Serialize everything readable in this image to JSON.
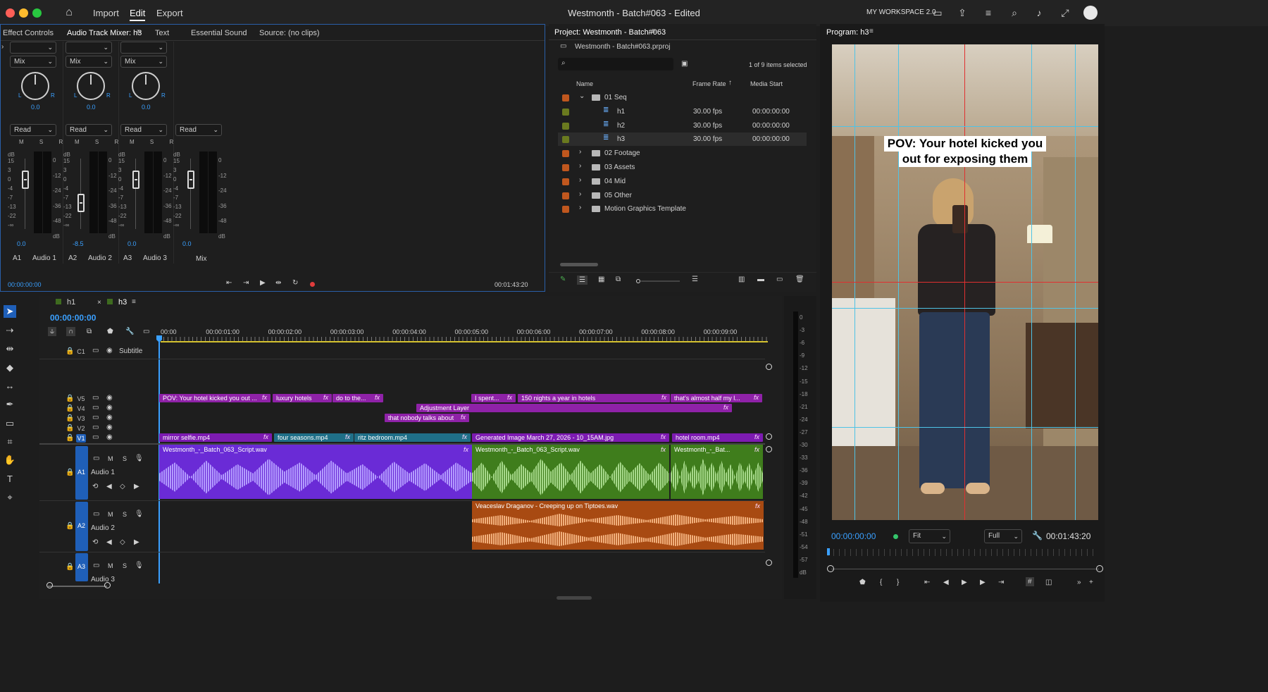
{
  "app": {
    "menu": {
      "import": "Import",
      "edit": "Edit",
      "export": "Export"
    },
    "title": "Westmonth - Batch#063 - Edited",
    "workspace": "MY WORKSPACE 2.0"
  },
  "top_left_panel": {
    "tabs": [
      "Effect Controls",
      "Audio Track Mixer: h3",
      "Text",
      "Essential Sound",
      "Source: (no clips)"
    ],
    "channels": [
      {
        "mode": "Mix",
        "pan": "0.0",
        "read": "Read",
        "fader": "0.0",
        "id": "A1",
        "name": "Audio 1"
      },
      {
        "mode": "Mix",
        "pan": "0.0",
        "read": "Read",
        "fader": "-8.5",
        "id": "A2",
        "name": "Audio 2"
      },
      {
        "mode": "Mix",
        "pan": "0.0",
        "read": "Read",
        "fader": "0.0",
        "id": "A3",
        "name": "Audio 3"
      },
      {
        "read": "Read",
        "fader": "0.0",
        "name": "Mix"
      }
    ],
    "pan_l": "L",
    "pan_r": "R",
    "msr": "M S R",
    "db": "dB",
    "left_scale": [
      "15",
      "3",
      "0",
      "-4",
      "-7",
      "-13",
      "-22",
      "-∞"
    ],
    "right_scale": [
      "0",
      "-12",
      "-24",
      "-36",
      "-48",
      "dB"
    ],
    "timecode_in": "00:00:00:00",
    "timecode_out": "00:01:43:20"
  },
  "project": {
    "title": "Project: Westmonth - Batch#063",
    "file": "Westmonth - Batch#063.prproj",
    "selected": "1 of 9 items selected",
    "cols": {
      "name": "Name",
      "frame_rate": "Frame Rate",
      "media_start": "Media Start"
    },
    "rows": [
      {
        "name": "01 Seq",
        "color": "#c0571e",
        "type": "folder-open"
      },
      {
        "name": "h1",
        "fps": "30.00 fps",
        "start": "00:00:00:00",
        "color": "#6a7a1f",
        "type": "seq"
      },
      {
        "name": "h2",
        "fps": "30.00 fps",
        "start": "00:00:00:00",
        "color": "#6a7a1f",
        "type": "seq"
      },
      {
        "name": "h3",
        "fps": "30.00 fps",
        "start": "00:00:00:00",
        "color": "#6a7a1f",
        "type": "seq"
      },
      {
        "name": "02 Footage",
        "color": "#c0571e",
        "type": "folder"
      },
      {
        "name": "03 Assets",
        "color": "#c0571e",
        "type": "folder"
      },
      {
        "name": "04 Mid",
        "color": "#c0571e",
        "type": "folder"
      },
      {
        "name": "05 Other",
        "color": "#c0571e",
        "type": "folder"
      },
      {
        "name": "Motion Graphics Template",
        "color": "#c0571e",
        "type": "folder"
      }
    ]
  },
  "program": {
    "title": "Program: h3",
    "caption_line1": "POV: Your hotel kicked you",
    "caption_line2": "out for exposing them",
    "timecode": "00:00:00:00",
    "fit": "Fit",
    "quality": "Full",
    "duration": "00:01:43:20"
  },
  "timeline": {
    "tabs": [
      "h1",
      "h3"
    ],
    "timecode": "00:00:00:00",
    "ruler": [
      "00:00",
      "00:00:01:00",
      "00:00:02:00",
      "00:00:03:00",
      "00:00:04:00",
      "00:00:05:00",
      "00:00:06:00",
      "00:00:07:00",
      "00:00:08:00",
      "00:00:09:00"
    ],
    "tracks": {
      "c1": "C1",
      "subtitle": "Subtitle",
      "v5": "V5",
      "v4": "V4",
      "v3": "V3",
      "v2": "V2",
      "v1": "V1",
      "a1": "A1",
      "audio1": "Audio 1",
      "a2": "A2",
      "audio2": "Audio 2",
      "a3": "A3",
      "audio3": "Audio 3"
    },
    "clips": {
      "v5": [
        "POV: Your hotel kicked you  out ...",
        "luxury hotels",
        "do to the...",
        "I spent...",
        "150 nights a year in hotels",
        "that's almost half my l..."
      ],
      "v4": "Adjustment Layer",
      "v3": "that nobody talks about",
      "v1": [
        "mirror selfie.mp4",
        "four seasons.mp4",
        "ritz bedroom.mp4",
        "Generated Image March 27, 2026 - 10_15AM.jpg",
        "hotel room.mp4"
      ],
      "a1": [
        "Westmonth_-_Batch_063_Script.wav",
        "Westmonth_-_Batch_063_Script.wav",
        "Westmonth_-_Bat..."
      ],
      "a2": "Veaceslav Draganov - Creeping up on Tiptoes.wav"
    },
    "fx": "fx",
    "meter_scale": [
      "0",
      "-3",
      "-6",
      "-9",
      "-12",
      "-15",
      "-18",
      "-21",
      "-24",
      "-27",
      "-30",
      "-33",
      "-36",
      "-39",
      "-42",
      "-45",
      "-48",
      "-51",
      "-54",
      "-57",
      "dB"
    ]
  }
}
